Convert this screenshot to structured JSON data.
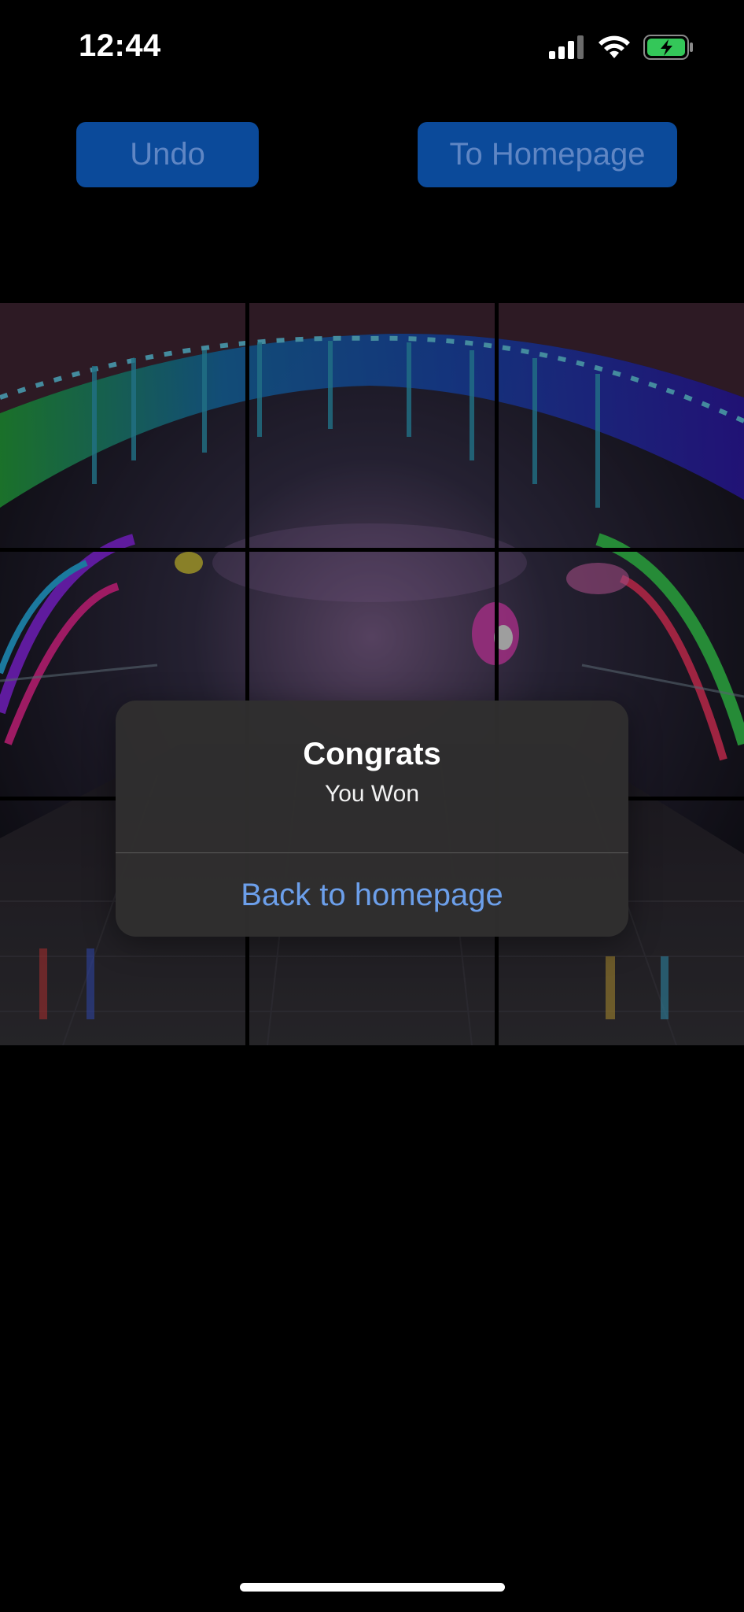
{
  "status_bar": {
    "time": "12:44",
    "signal_icon": "cellular-signal-icon",
    "wifi_icon": "wifi-icon",
    "battery_icon": "battery-charging-icon",
    "battery_color": "#34c759"
  },
  "toolbar": {
    "undo_label": "Undo",
    "home_label": "To Homepage",
    "button_color": "#0b4a9a"
  },
  "board": {
    "rows": 3,
    "cols": 3
  },
  "alert": {
    "title": "Congrats",
    "message": "You Won",
    "action_label": "Back to homepage",
    "action_color": "#6c9fea"
  }
}
